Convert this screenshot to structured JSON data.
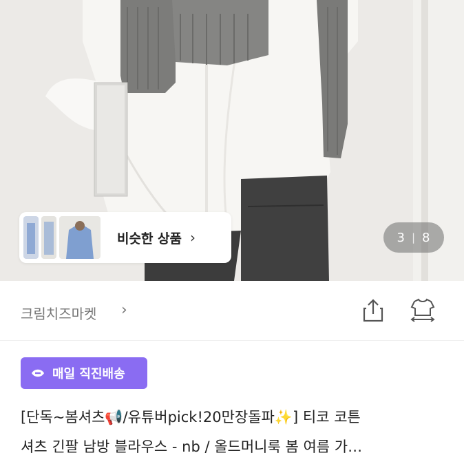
{
  "product_image": {
    "alt_icon": "product-photo"
  },
  "similar_products": {
    "label": "비슷한 상품",
    "chevron": "›"
  },
  "image_counter": {
    "current": "3",
    "separator": "|",
    "total": "8"
  },
  "seller": {
    "name": "크림치즈마켓",
    "chevron": "›"
  },
  "actions": {
    "share_icon": "share-icon",
    "compare_icon": "compare-icon"
  },
  "badge": {
    "label": "매일 직진배송",
    "accent": "#8a6cf2"
  },
  "product_title": {
    "line1": "[단독~봄셔츠📢/유튜버pick!20만장돌파✨] 티코 코튼",
    "line2": "셔츠 긴팔 남방 블라우스 - nb / 올드머니룩 봄 여름 가…"
  }
}
